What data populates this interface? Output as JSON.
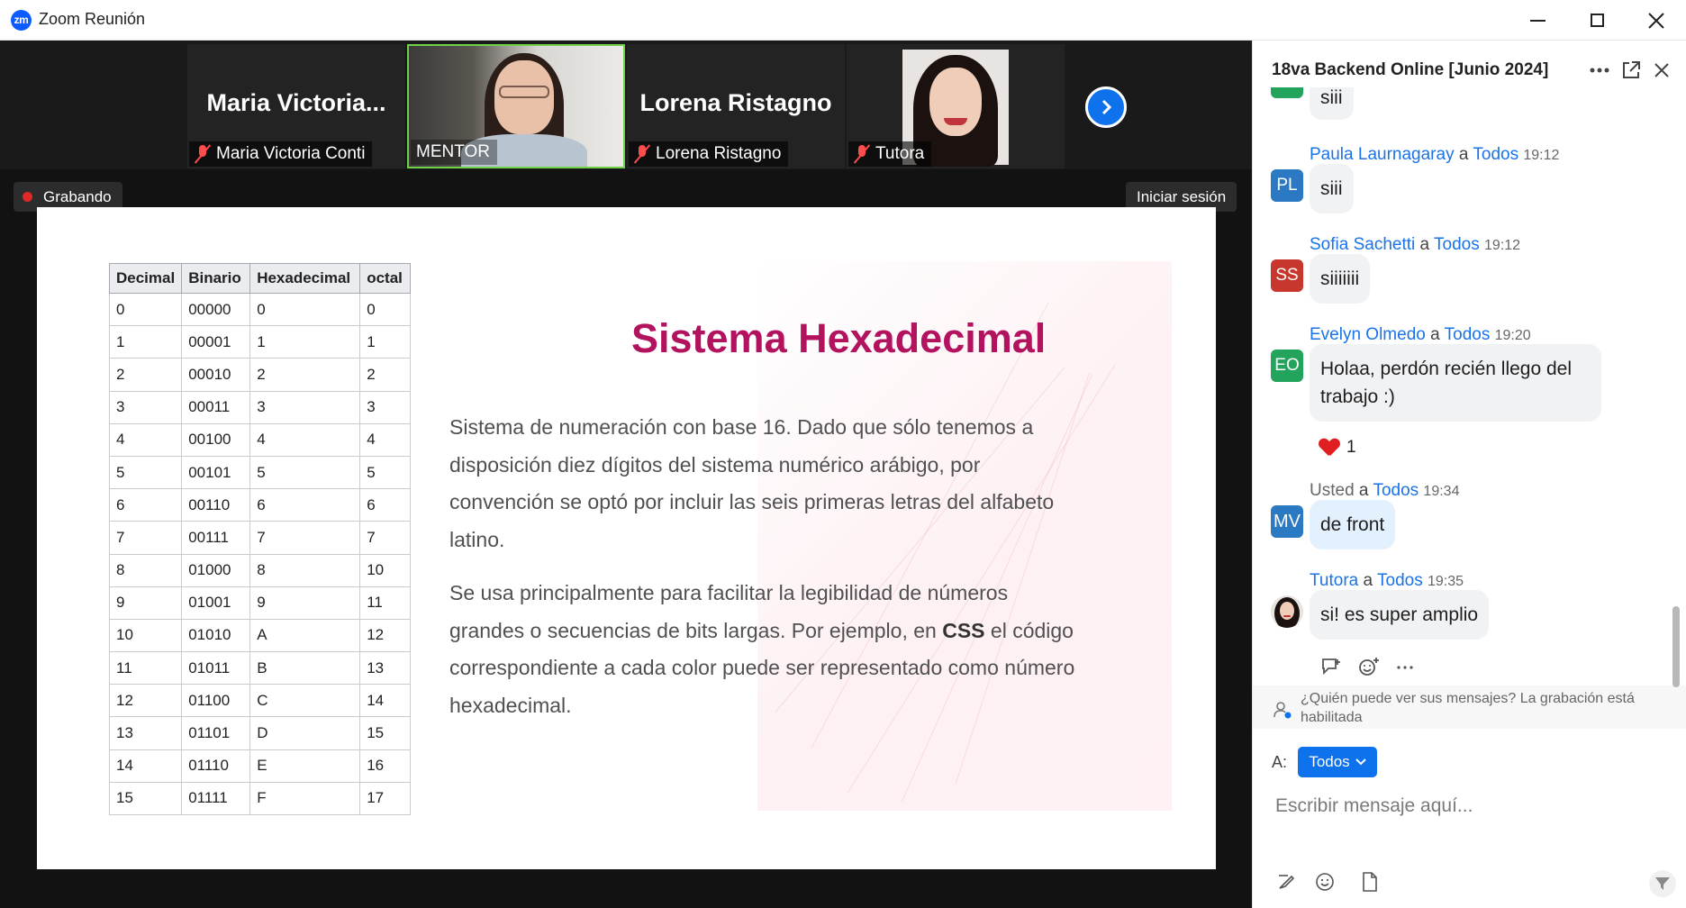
{
  "window": {
    "app_logo": "zm",
    "title": "Zoom Reunión",
    "icons": [
      "minimize-icon",
      "maximize-icon",
      "close-icon"
    ]
  },
  "participants": [
    {
      "display_name": "Maria  Victoria...",
      "label": "Maria Victoria Conti",
      "muted": true,
      "video": false
    },
    {
      "display_name": "",
      "label": "MENTOR",
      "muted": false,
      "video": true,
      "active_speaker": true
    },
    {
      "display_name": "Lorena Ristagno",
      "label": "Lorena Ristagno",
      "muted": true,
      "video": false
    },
    {
      "display_name": "",
      "label": "Tutora",
      "muted": true,
      "video": false,
      "photo": true
    }
  ],
  "meeting_overlay": {
    "recording_label": "Grabando",
    "sign_in_label": "Iniciar sesión"
  },
  "slide": {
    "table": {
      "headers": [
        "Decimal",
        "Binario",
        "Hexadecimal",
        "octal"
      ],
      "rows": [
        [
          "0",
          "00000",
          "0",
          "0"
        ],
        [
          "1",
          "00001",
          "1",
          "1"
        ],
        [
          "2",
          "00010",
          "2",
          "2"
        ],
        [
          "3",
          "00011",
          "3",
          "3"
        ],
        [
          "4",
          "00100",
          "4",
          "4"
        ],
        [
          "5",
          "00101",
          "5",
          "5"
        ],
        [
          "6",
          "00110",
          "6",
          "6"
        ],
        [
          "7",
          "00111",
          "7",
          "7"
        ],
        [
          "8",
          "01000",
          "8",
          "10"
        ],
        [
          "9",
          "01001",
          "9",
          "11"
        ],
        [
          "10",
          "01010",
          "A",
          "12"
        ],
        [
          "11",
          "01011",
          "B",
          "13"
        ],
        [
          "12",
          "01100",
          "C",
          "14"
        ],
        [
          "13",
          "01101",
          "D",
          "15"
        ],
        [
          "14",
          "01110",
          "E",
          "16"
        ],
        [
          "15",
          "01111",
          "F",
          "17"
        ]
      ]
    },
    "title": "Sistema Hexadecimal",
    "title_color": "#b3125f",
    "paragraph1": "Sistema de numeración con base 16. Dado que sólo tenemos a disposición diez dígitos del sistema numérico arábigo, por convención se optó por incluir las seis primeras letras del alfabeto latino.",
    "paragraph2_before": "Se usa principalmente para facilitar la legibilidad de números grandes o secuencias de bits largas. Por ejemplo, en ",
    "paragraph2_bold": "CSS",
    "paragraph2_after": " el código correspondiente a cada color puede ser representado como número hexadecimal."
  },
  "chat": {
    "title": "18va Backend Online [Junio 2024]",
    "partial_message": "siii",
    "messages": [
      {
        "sender": "Paula Laurnagaray",
        "to_word": "a",
        "to": "Todos",
        "time": "19:12",
        "initials": "PL",
        "avatar_color": "#2b79c2",
        "text": "siii"
      },
      {
        "sender": "Sofia Sachetti",
        "to_word": "a",
        "to": "Todos",
        "time": "19:12",
        "initials": "SS",
        "avatar_color": "#c8372d",
        "text": "siiiiiii"
      },
      {
        "sender": "Evelyn Olmedo",
        "to_word": "a",
        "to": "Todos",
        "time": "19:20",
        "initials": "EO",
        "avatar_color": "#22a45d",
        "text": "Holaa, perdón recién llego del trabajo :)",
        "reaction_count": "1"
      },
      {
        "sender": "Usted",
        "to_word": "a",
        "to": "Todos",
        "time": "19:34",
        "initials": "MV",
        "avatar_color": "#2b79c2",
        "text": "de front"
      },
      {
        "sender": "Tutora",
        "to_word": "a",
        "to": "Todos",
        "time": "19:35",
        "initials": "",
        "text": "si! es super amplio"
      }
    ],
    "privacy_note": "¿Quién puede ver sus mensajes? La grabación está habilitada",
    "to_label": "A:",
    "recipient": "Todos",
    "compose_placeholder": "Escribir mensaje aquí..."
  },
  "colors": {
    "accent": "#0e72ed",
    "link": "#1a73e8",
    "recording": "#e02828",
    "speaker_border": "#6fd14a"
  }
}
